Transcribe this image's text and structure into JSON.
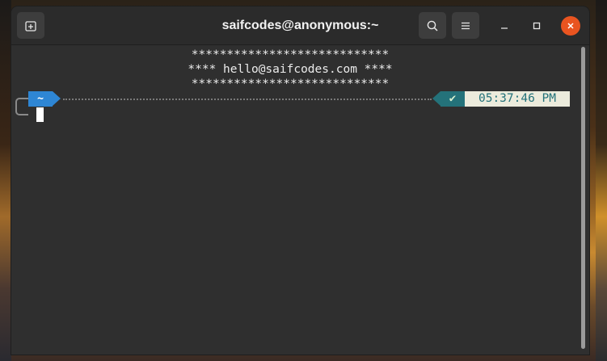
{
  "window": {
    "title": "saifcodes@anonymous:~"
  },
  "toolbar": {
    "new_tab_icon": "new-tab-icon",
    "search_icon": "search-icon",
    "menu_icon": "hamburger-menu-icon",
    "minimize_icon": "minimize-icon",
    "maximize_icon": "maximize-icon",
    "close_icon": "close-icon"
  },
  "terminal": {
    "banner": [
      "****************************",
      "**** hello@saifcodes.com ****",
      "****************************"
    ],
    "prompt": {
      "directory": "~",
      "status_symbol": "✔",
      "time": "05:37:46 PM"
    }
  },
  "colors": {
    "close_button": "#e95420",
    "directory_segment": "#2e86d4",
    "status_segment": "#24727a",
    "time_segment": "#ecebdc"
  }
}
